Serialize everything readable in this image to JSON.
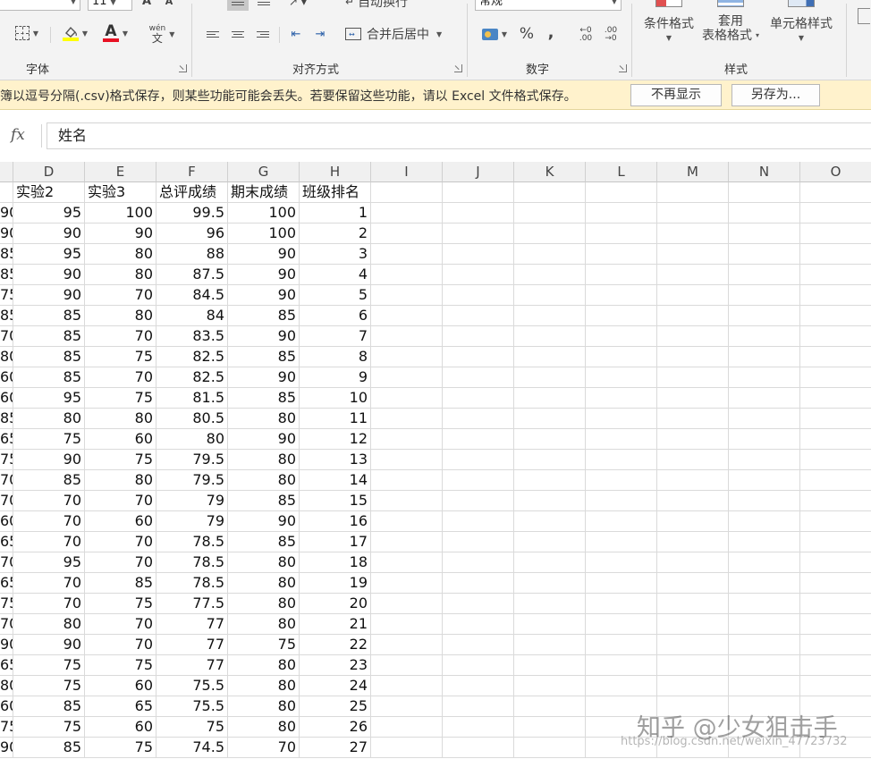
{
  "ribbon": {
    "font_size_value": "11",
    "number_format_value": "常规",
    "wrap_text_label": "自动换行",
    "merge_center_label": "合并后居中",
    "percent_label": "%",
    "comma_label": ",",
    "phonetic_top": "wén",
    "phonetic_bottom": "文",
    "font_grow_label": "A",
    "font_shrink_label": "A",
    "font_color_letter": "A",
    "conditional_format_label": "条件格式",
    "table_format_label_1": "套用",
    "table_format_label_2": "表格格式",
    "cell_style_label": "单元格样式",
    "groups": {
      "font": "字体",
      "alignment": "对齐方式",
      "number": "数字",
      "styles": "样式"
    },
    "colors": {
      "highlight": "#ffff00",
      "font_color": "#e81123"
    }
  },
  "infobar": {
    "message": "簿以逗号分隔(.csv)格式保存，则某些功能可能会丢失。若要保留这些功能，请以 Excel 文件格式保存。",
    "dont_show_again": "不再显示",
    "save_as": "另存为..."
  },
  "formula_bar": {
    "fx": "fx",
    "value": "姓名"
  },
  "sheet": {
    "columns": [
      "D",
      "E",
      "F",
      "G",
      "H",
      "I",
      "J",
      "K",
      "L",
      "M",
      "N",
      "O"
    ],
    "header_row": [
      "实验2",
      "实验3",
      "总评成绩",
      "期末成绩",
      "班级排名"
    ],
    "partial_c": [
      "90",
      "90",
      "85",
      "85",
      "75",
      "85",
      "70",
      "80",
      "60",
      "60",
      "85",
      "65",
      "75",
      "70",
      "70",
      "60",
      "65",
      "70",
      "65",
      "75",
      "70",
      "90",
      "65",
      "80",
      "60",
      "75",
      "90"
    ],
    "rows": [
      [
        "95",
        "100",
        "99.5",
        "100",
        "1"
      ],
      [
        "90",
        "90",
        "96",
        "100",
        "2"
      ],
      [
        "95",
        "80",
        "88",
        "90",
        "3"
      ],
      [
        "90",
        "80",
        "87.5",
        "90",
        "4"
      ],
      [
        "90",
        "70",
        "84.5",
        "90",
        "5"
      ],
      [
        "85",
        "80",
        "84",
        "85",
        "6"
      ],
      [
        "85",
        "70",
        "83.5",
        "90",
        "7"
      ],
      [
        "85",
        "75",
        "82.5",
        "85",
        "8"
      ],
      [
        "85",
        "70",
        "82.5",
        "90",
        "9"
      ],
      [
        "95",
        "75",
        "81.5",
        "85",
        "10"
      ],
      [
        "80",
        "80",
        "80.5",
        "80",
        "11"
      ],
      [
        "75",
        "60",
        "80",
        "90",
        "12"
      ],
      [
        "90",
        "75",
        "79.5",
        "80",
        "13"
      ],
      [
        "85",
        "80",
        "79.5",
        "80",
        "14"
      ],
      [
        "70",
        "70",
        "79",
        "85",
        "15"
      ],
      [
        "70",
        "60",
        "79",
        "90",
        "16"
      ],
      [
        "70",
        "70",
        "78.5",
        "85",
        "17"
      ],
      [
        "95",
        "70",
        "78.5",
        "80",
        "18"
      ],
      [
        "70",
        "85",
        "78.5",
        "80",
        "19"
      ],
      [
        "70",
        "75",
        "77.5",
        "80",
        "20"
      ],
      [
        "80",
        "70",
        "77",
        "80",
        "21"
      ],
      [
        "90",
        "70",
        "77",
        "75",
        "22"
      ],
      [
        "75",
        "75",
        "77",
        "80",
        "23"
      ],
      [
        "75",
        "60",
        "75.5",
        "80",
        "24"
      ],
      [
        "85",
        "65",
        "75.5",
        "80",
        "25"
      ],
      [
        "75",
        "60",
        "75",
        "80",
        "26"
      ],
      [
        "85",
        "75",
        "74.5",
        "70",
        "27"
      ]
    ]
  },
  "watermark": {
    "text": "知乎 @少女狙击手",
    "url": "https://blog.csdn.net/weixin_47723732"
  }
}
